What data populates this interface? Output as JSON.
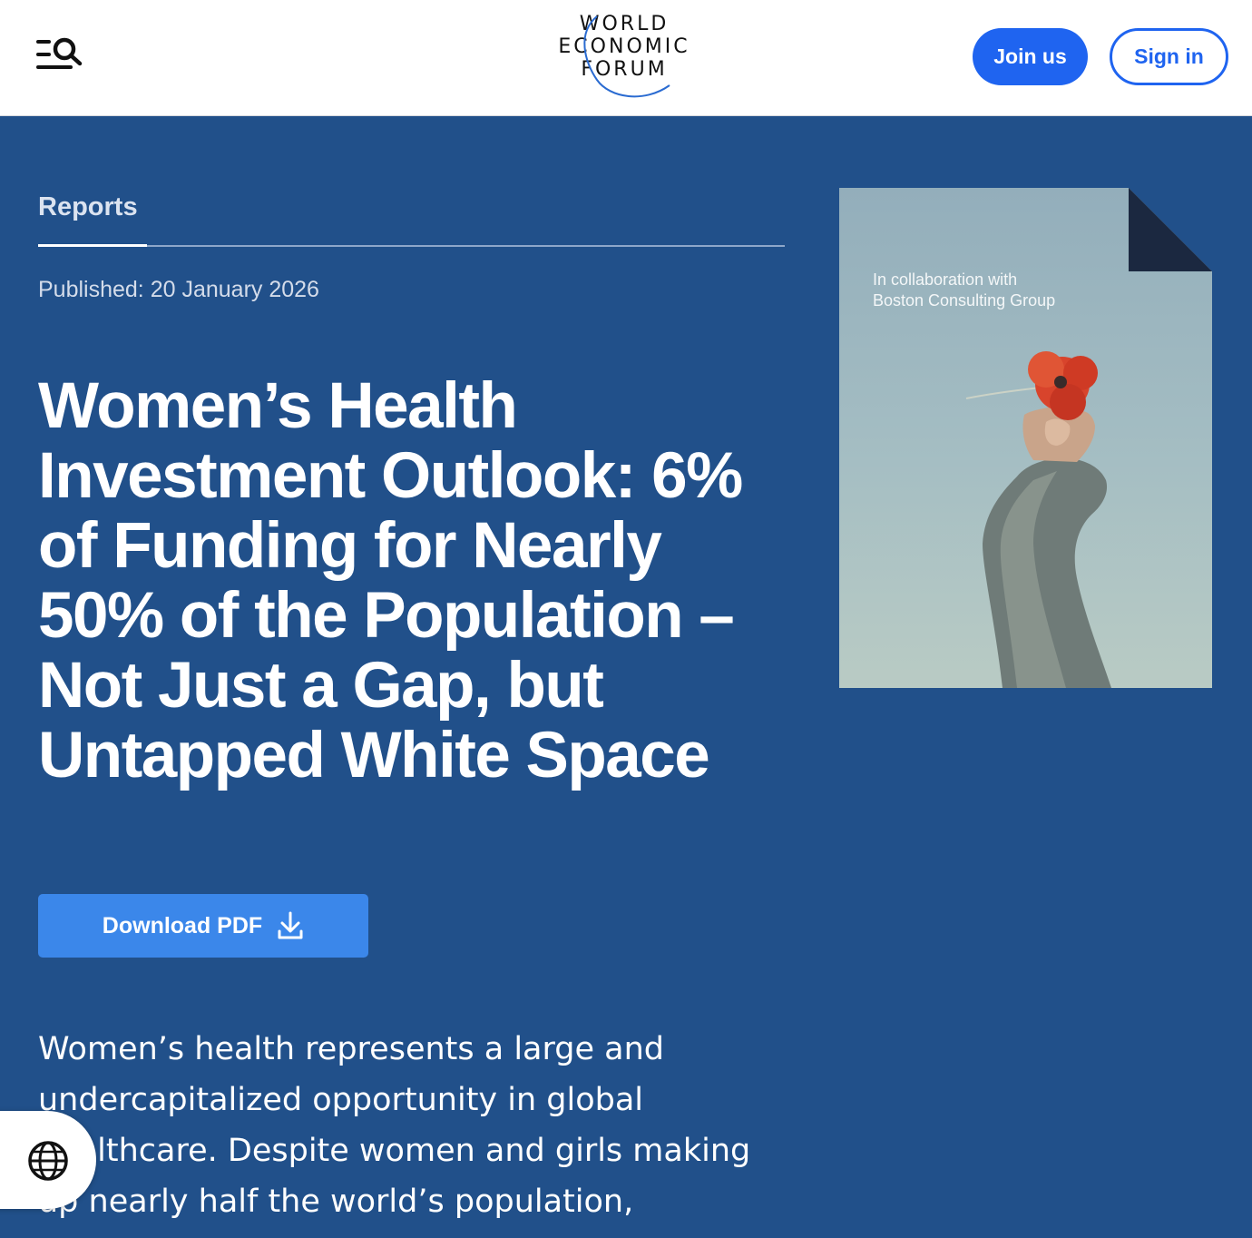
{
  "header": {
    "logo": {
      "line1": "WORLD",
      "line2": "ECONOMIC",
      "line3": "FORUM"
    },
    "menu_icon": "menu-search-icon",
    "join_label": "Join us",
    "signin_label": "Sign in"
  },
  "hero": {
    "section_label": "Reports",
    "published": "Published: 20 January 2026",
    "title": "Women’s Health Investment Outlook: 6% of Funding for Nearly 50% of the Population – Not Just a Gap, but Untapped White Space",
    "download_label": "Download PDF",
    "download_icon": "download-icon",
    "summary": "Women’s health represents a large and undercapitalized opportunity in global healthcare. Despite women and girls making up nearly half the world’s population,"
  },
  "cover": {
    "caption_line1": "In collaboration with",
    "caption_line2": "Boston Consulting Group"
  },
  "language": {
    "icon": "globe-icon"
  },
  "colors": {
    "hero_background": "#21508a",
    "accent": "#1f64f0",
    "download_button": "#3b87ea",
    "cover_corner": "#1b2840"
  }
}
